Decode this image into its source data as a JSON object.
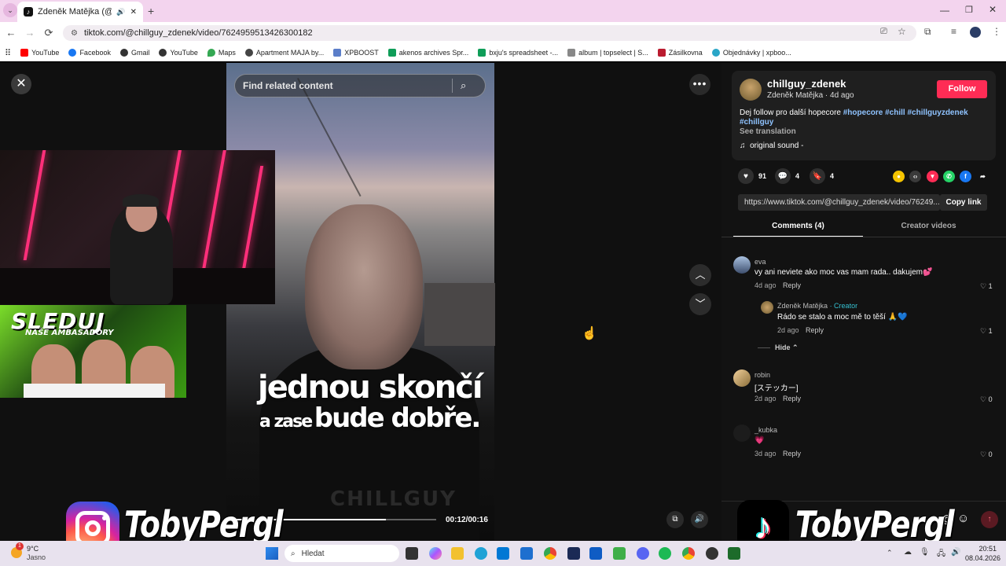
{
  "browser": {
    "tab_title": "Zdeněk Matějka (@chillguy",
    "url": "tiktok.com/@chillguy_zdenek/video/7624959513426300182",
    "bookmarks": [
      {
        "label": "YouTube",
        "color": "#ff0000"
      },
      {
        "label": "Facebook",
        "color": "#1877f2"
      },
      {
        "label": "Gmail",
        "color": "#333333"
      },
      {
        "label": "YouTube",
        "color": "#333333"
      },
      {
        "label": "Maps",
        "color": "#34a853"
      },
      {
        "label": "Apartment MAJA by...",
        "color": "#444444"
      },
      {
        "label": "XPBOOST",
        "color": "#5b7ec9"
      },
      {
        "label": "akenos archives Spr...",
        "color": "#0f9d58"
      },
      {
        "label": "bxju's spreadsheet -...",
        "color": "#0f9d58"
      },
      {
        "label": "album | topselect | S...",
        "color": "#888888"
      },
      {
        "label": "Zásilkovna",
        "color": "#ba1b2f"
      },
      {
        "label": "Objednávky | xpboo...",
        "color": "#2aa6c7"
      }
    ]
  },
  "player": {
    "search_placeholder": "Find related content",
    "caption_line1": "jednou skončí",
    "caption_line2_small": "a zase",
    "caption_line2_big": "bude dobře.",
    "shirt_text": "CHILLGUY",
    "time": "00:12/00:16",
    "progress": 0.75
  },
  "overlay": {
    "ambassador_title": "SLEDUJ",
    "ambassador_sub": "NAŠE AMBASADORY",
    "instagram_handle": "TobyPergl",
    "tiktok_handle": "TobyPergl"
  },
  "creator": {
    "username": "chillguy_zdenek",
    "display": "Zdeněk Matějka · 4d ago",
    "follow": "Follow",
    "desc_text": "Dej follow pro další hopecore ",
    "tags": [
      "#hopecore",
      "#chill",
      "#chillguyzdenek",
      "#chillguy"
    ],
    "see_translation": "See translation",
    "sound": "original sound -"
  },
  "stats": {
    "likes": "91",
    "comments": "4",
    "saves": "4"
  },
  "share": {
    "link": "https://www.tiktok.com/@chillguy_zdenek/video/76249...",
    "copy_label": "Copy link"
  },
  "tabs": {
    "comments": "Comments (4)",
    "creator_videos": "Creator videos"
  },
  "comments": [
    {
      "user": "eva",
      "text": "vy ani neviete ako moc vas mam rada.. dakujem💕",
      "age": "4d ago",
      "likes": "1"
    },
    {
      "user": "Zdeněk Matějka",
      "creator_badge": "· Creator",
      "text": "Rádo se stalo a moc mě to těší 🙏💙",
      "age": "2d ago",
      "likes": "1"
    },
    {
      "user": "robin",
      "text": "[ステッカー]",
      "age": "2d ago",
      "likes": "0"
    },
    {
      "user": "_kubka",
      "text": "💗",
      "age": "3d ago",
      "likes": "0"
    }
  ],
  "reply_label": "Reply",
  "hide_label": "Hide",
  "taskbar": {
    "temp": "9°C",
    "weather": "Jasno",
    "search": "Hledat",
    "time": "20:51",
    "date": "08.04.2026",
    "notification_count": "1"
  }
}
